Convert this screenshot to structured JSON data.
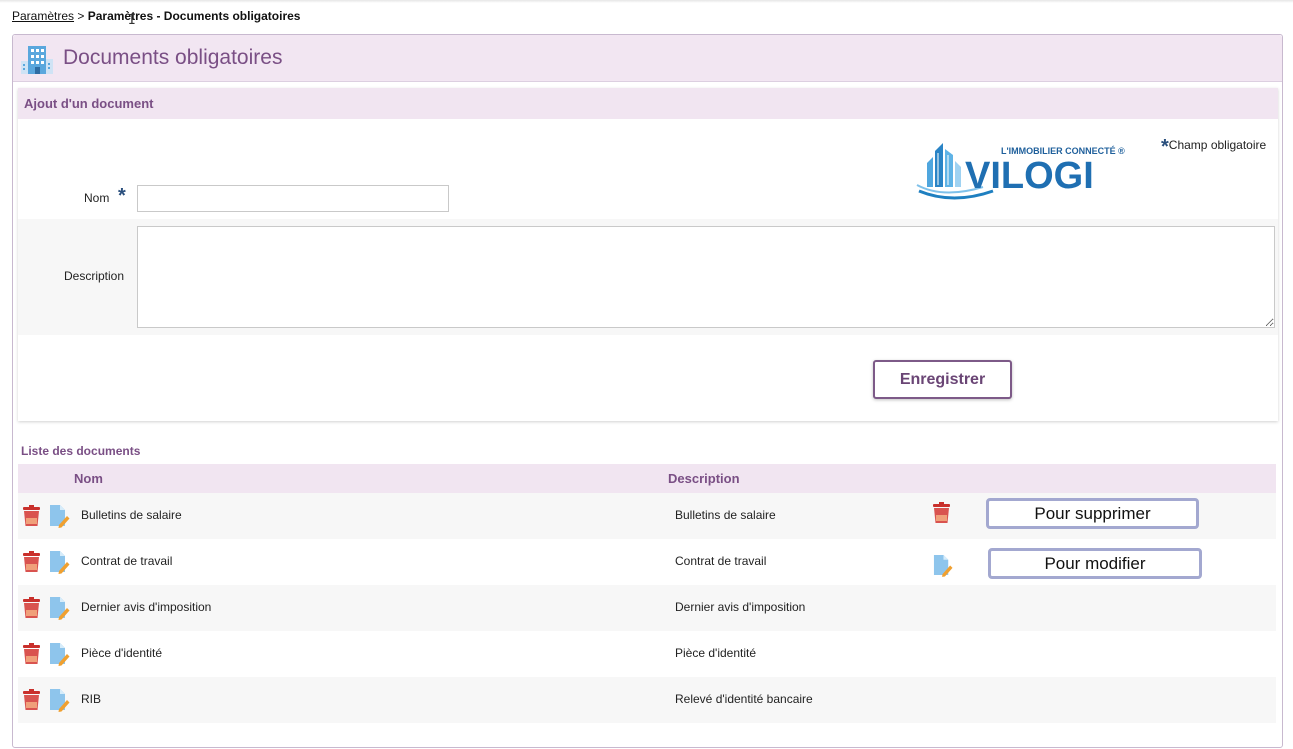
{
  "breadcrumb": {
    "parent": "Paramètres",
    "separator": ">",
    "current": "Paramètres - Documents obligatoires"
  },
  "page": {
    "title": "Documents obligatoires",
    "icon": "building-icon"
  },
  "add_form": {
    "title": "Ajout d'un document",
    "required_note": "Champ obligatoire",
    "required_marker": "*",
    "nom_label": "Nom",
    "nom_value": "",
    "description_label": "Description",
    "description_value": "",
    "save_label": "Enregistrer"
  },
  "logo": {
    "tagline": "L'IMMOBILIER CONNECTÉ ®",
    "brand": "VILOGI"
  },
  "list": {
    "title": "Liste des documents",
    "columns": {
      "nom": "Nom",
      "description": "Description"
    },
    "rows": [
      {
        "nom": "Bulletins de salaire",
        "description": "Bulletins de salaire"
      },
      {
        "nom": "Contrat de travail",
        "description": "Contrat de travail"
      },
      {
        "nom": "Dernier avis d'imposition",
        "description": "Dernier avis d'imposition"
      },
      {
        "nom": "Pièce d'identité",
        "description": "Pièce d'identité"
      },
      {
        "nom": "RIB",
        "description": "Relevé d'identité bancaire"
      }
    ]
  },
  "legend": {
    "delete_label": "Pour supprimer",
    "edit_label": "Pour modifier"
  },
  "colors": {
    "accent": "#7a4f85",
    "header_bg": "#f2e6f2",
    "required_star": "#2a4f7d",
    "trash_red": "#d9534f",
    "doc_blue": "#8ec5ec",
    "pencil_orange": "#f0a030"
  }
}
